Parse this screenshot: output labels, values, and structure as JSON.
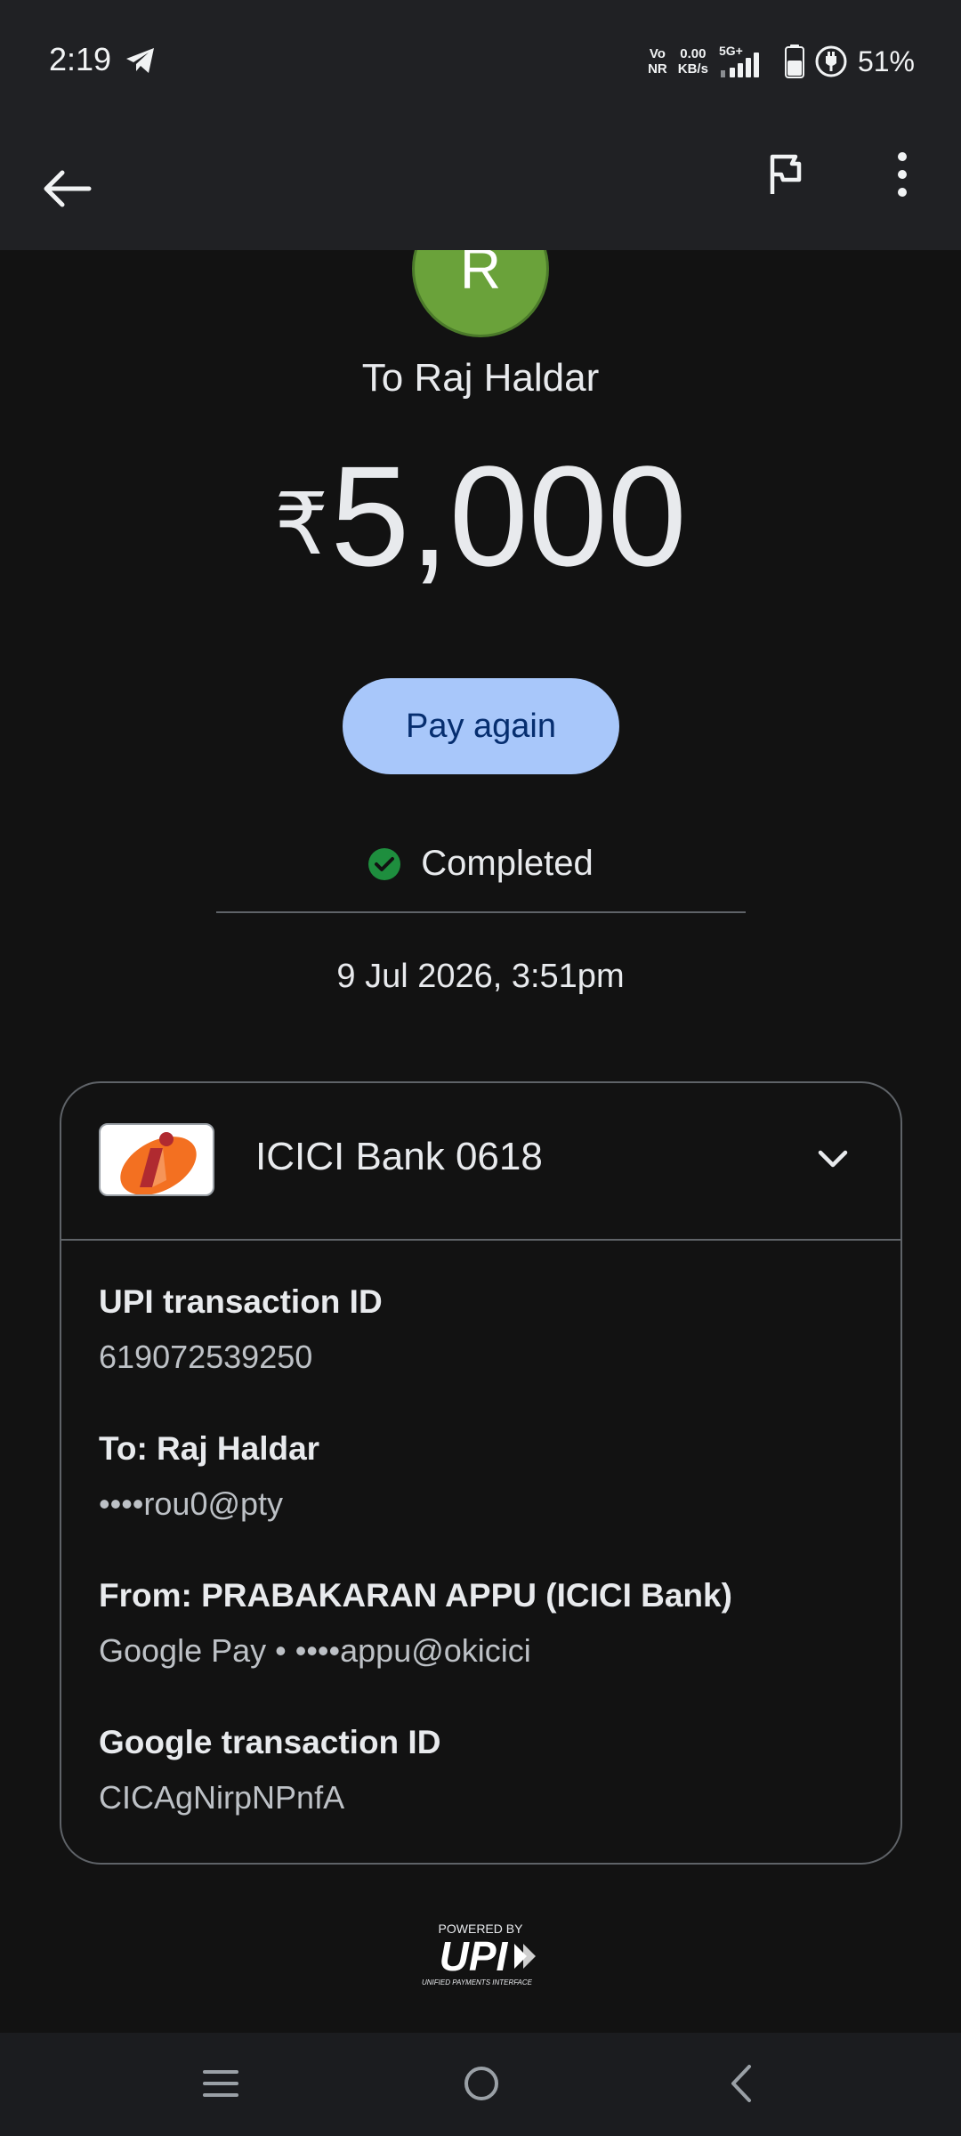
{
  "status_bar": {
    "time": "2:19",
    "volte_top": "Vo",
    "volte_bottom": "NR",
    "speed_top": "0.00",
    "speed_bottom": "KB/s",
    "network": "5G+",
    "battery_percent": "51%"
  },
  "payment": {
    "avatar_initial": "R",
    "recipient_title": "To Raj Haldar",
    "currency_symbol": "₹",
    "amount": "5,000",
    "pay_again_label": "Pay again",
    "status": "Completed",
    "datetime": "9 Jul 2026, 3:51pm"
  },
  "details": {
    "bank_name": "ICICI Bank 0618",
    "upi_txn_label": "UPI transaction ID",
    "upi_txn_value": "619072539250",
    "to_label": "To: Raj Haldar",
    "to_value": "••••rou0@pty",
    "from_label": "From: PRABAKARAN APPU (ICICI Bank)",
    "from_value": "Google Pay • ••••appu@okicici",
    "google_txn_label": "Google transaction ID",
    "google_txn_value": "CICAgNirpNPnfA"
  },
  "footer": {
    "powered_by": "POWERED BY",
    "upi_text": "UPI",
    "upi_subtitle": "UNIFIED PAYMENTS INTERFACE"
  },
  "colors": {
    "background": "#121212",
    "app_bar": "#202124",
    "avatar": "#6aa23a",
    "pay_again_bg": "#a8c7fa",
    "pay_again_text": "#062e6f",
    "success": "#1e8e3e"
  }
}
